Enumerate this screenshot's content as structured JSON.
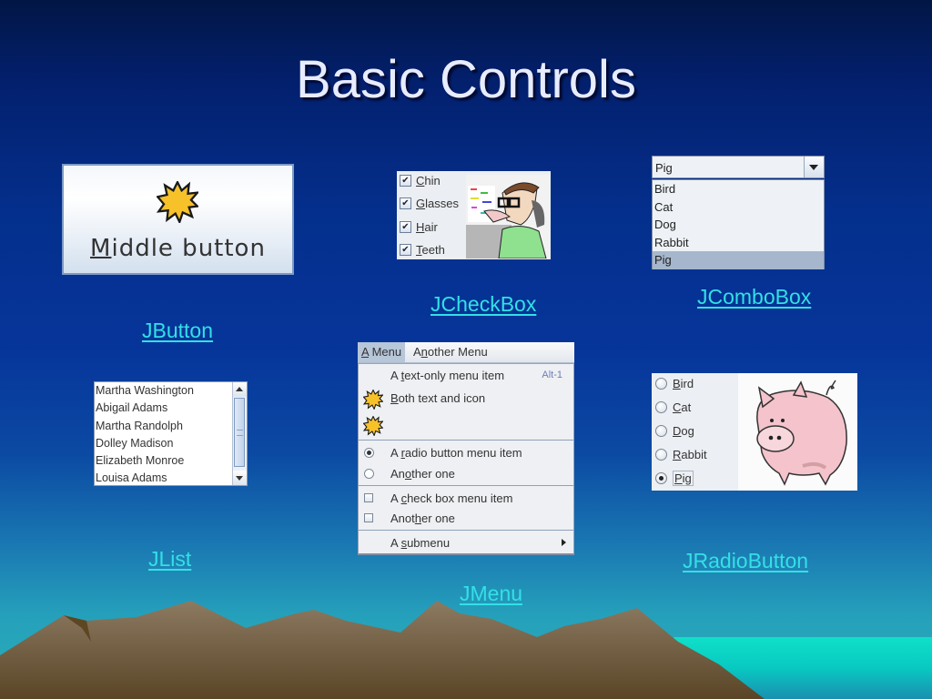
{
  "slide": {
    "title": "Basic Controls"
  },
  "links": {
    "jbutton": "JButton",
    "jcheckbox": "JCheckBox",
    "jcombobox": "JComboBox",
    "jlist": "JList",
    "jmenu": "JMenu",
    "jradiobutton": "JRadioButton"
  },
  "button_demo": {
    "label_mnemonic": "M",
    "label_rest": "iddle button",
    "icon": "star-burst-icon"
  },
  "checkbox_demo": {
    "items": [
      {
        "mnemonic": "C",
        "rest": "hin",
        "checked": true
      },
      {
        "mnemonic": "G",
        "rest": "lasses",
        "checked": true
      },
      {
        "mnemonic": "H",
        "rest": "air",
        "checked": true
      },
      {
        "mnemonic": "T",
        "rest": "eeth",
        "checked": true
      }
    ],
    "check_glyph": "✔",
    "image": "cartoon-face-image"
  },
  "combobox_demo": {
    "selected": "Pig",
    "options": [
      "Bird",
      "Cat",
      "Dog",
      "Rabbit",
      "Pig"
    ]
  },
  "list_demo": {
    "items": [
      "Martha Washington",
      "Abigail Adams",
      "Martha Randolph",
      "Dolley Madison",
      "Elizabeth Monroe",
      "Louisa Adams"
    ]
  },
  "menu_demo": {
    "menubar": [
      {
        "mnemonic": "A",
        "rest": " Menu",
        "active": true
      },
      {
        "pre": "A",
        "mnemonic": "n",
        "rest": "other Menu",
        "active": false
      }
    ],
    "items": {
      "text_only": {
        "pre": "A ",
        "mnemonic": "t",
        "rest": "ext-only menu item",
        "accelerator": "Alt-1"
      },
      "text_icon": {
        "pre": "",
        "mnemonic": "B",
        "rest": "oth text and icon"
      },
      "radio1": {
        "pre": "A ",
        "mnemonic": "r",
        "rest": "adio button menu item",
        "selected": true
      },
      "radio2": {
        "pre": "An",
        "mnemonic": "o",
        "rest": "ther one",
        "selected": false
      },
      "check1": {
        "pre": "A ",
        "mnemonic": "c",
        "rest": "heck box menu item",
        "checked": false
      },
      "check2": {
        "pre": "Anot",
        "mnemonic": "h",
        "rest": "er one",
        "checked": false
      },
      "submenu": {
        "pre": "A ",
        "mnemonic": "s",
        "rest": "ubmenu"
      }
    }
  },
  "radio_demo": {
    "options": [
      {
        "mnemonic": "B",
        "rest": "ird",
        "selected": false
      },
      {
        "mnemonic": "C",
        "rest": "at",
        "selected": false
      },
      {
        "mnemonic": "D",
        "rest": "og",
        "selected": false
      },
      {
        "mnemonic": "R",
        "rest": "abbit",
        "selected": false
      },
      {
        "mnemonic": "P",
        "rest": "ig",
        "selected": true
      }
    ],
    "image": "pig-drawing-image"
  },
  "colors": {
    "link": "#33e0e6",
    "title": "#e8ecff",
    "star": "#f7c12a"
  }
}
